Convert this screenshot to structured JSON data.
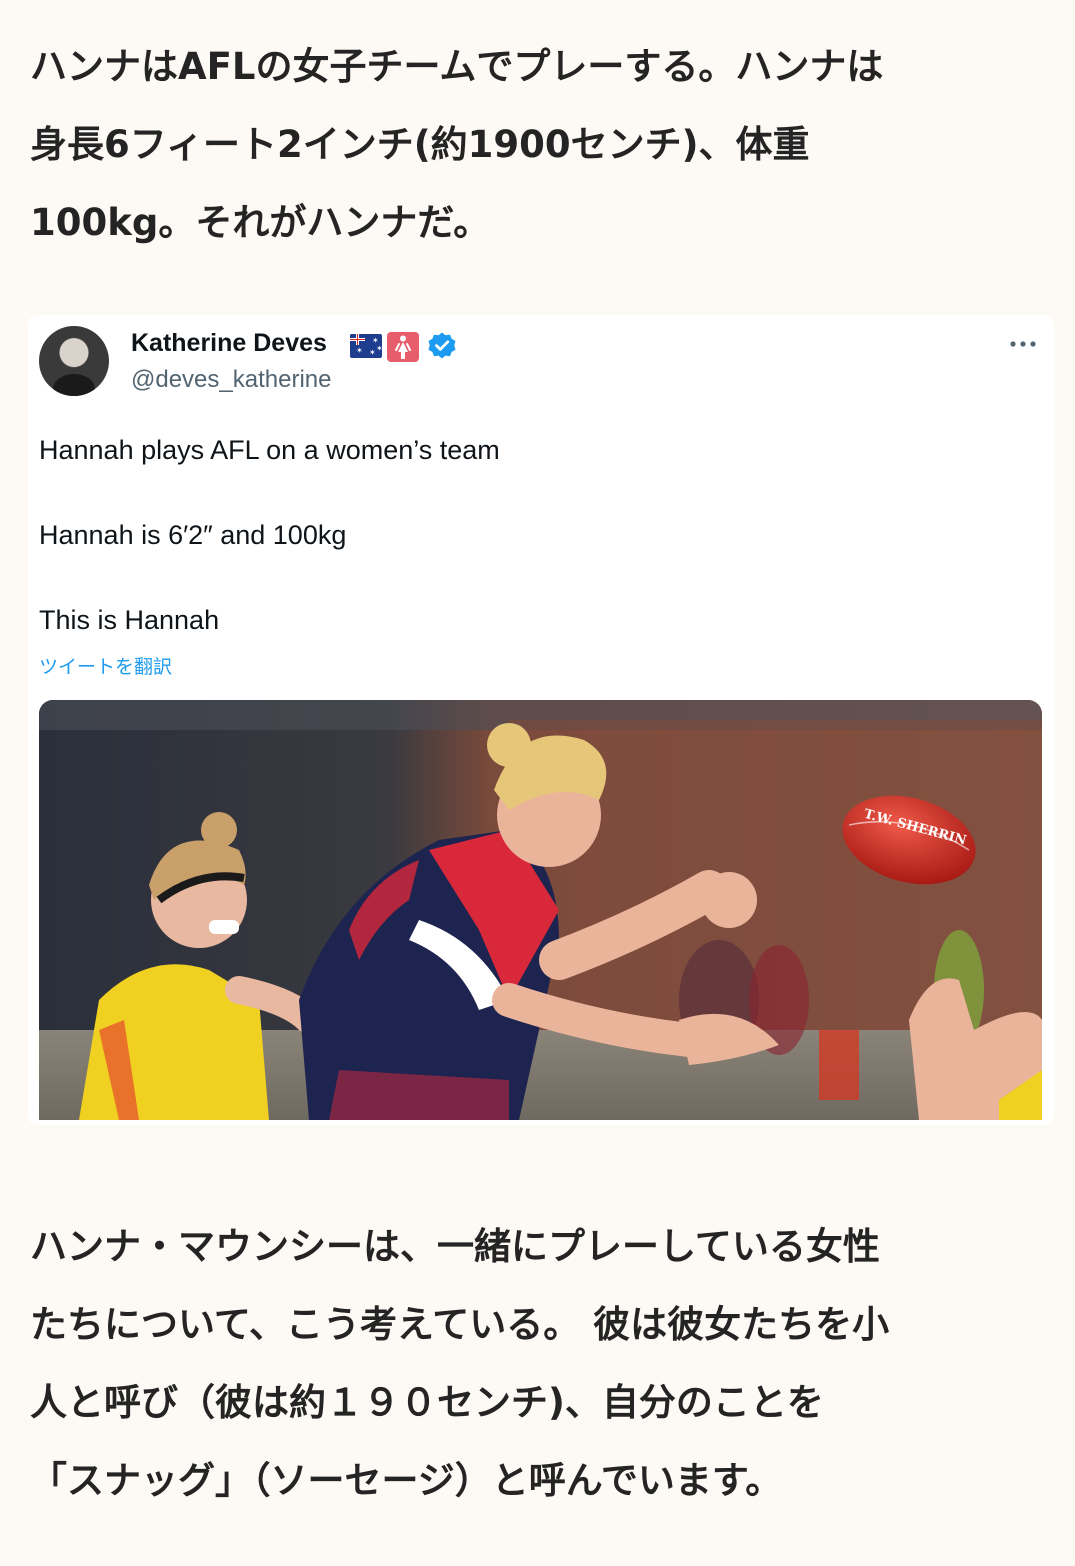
{
  "intro": {
    "lines": [
      "ハンナはAFLの女子チームでプレーする。ハンナは",
      "身長6フィート2インチ(約1900センチ)、体重",
      "100kg。それがハンナだ。"
    ]
  },
  "tweet": {
    "user_name": "Katherine Deves",
    "handle": "@deves_katherine",
    "lines": [
      "Hannah plays AFL on a women’s team",
      "Hannah is 6′2″ and 100kg",
      "This is Hannah"
    ],
    "translate_label": "ツイートを翻訳",
    "ball_brand": "T.W. SHERRIN",
    "accent_color": "#1d9bf0"
  },
  "outro": {
    "lines": [
      "ハンナ・マウンシーは、一緒にプレーしている女性",
      "たちについて、こう考えている。 彼は彼女たちを小",
      "人と呼び（彼は約１９０センチ)、自分のことを",
      "「スナッグ」（ソーセージ）と呼んでいます。"
    ]
  }
}
